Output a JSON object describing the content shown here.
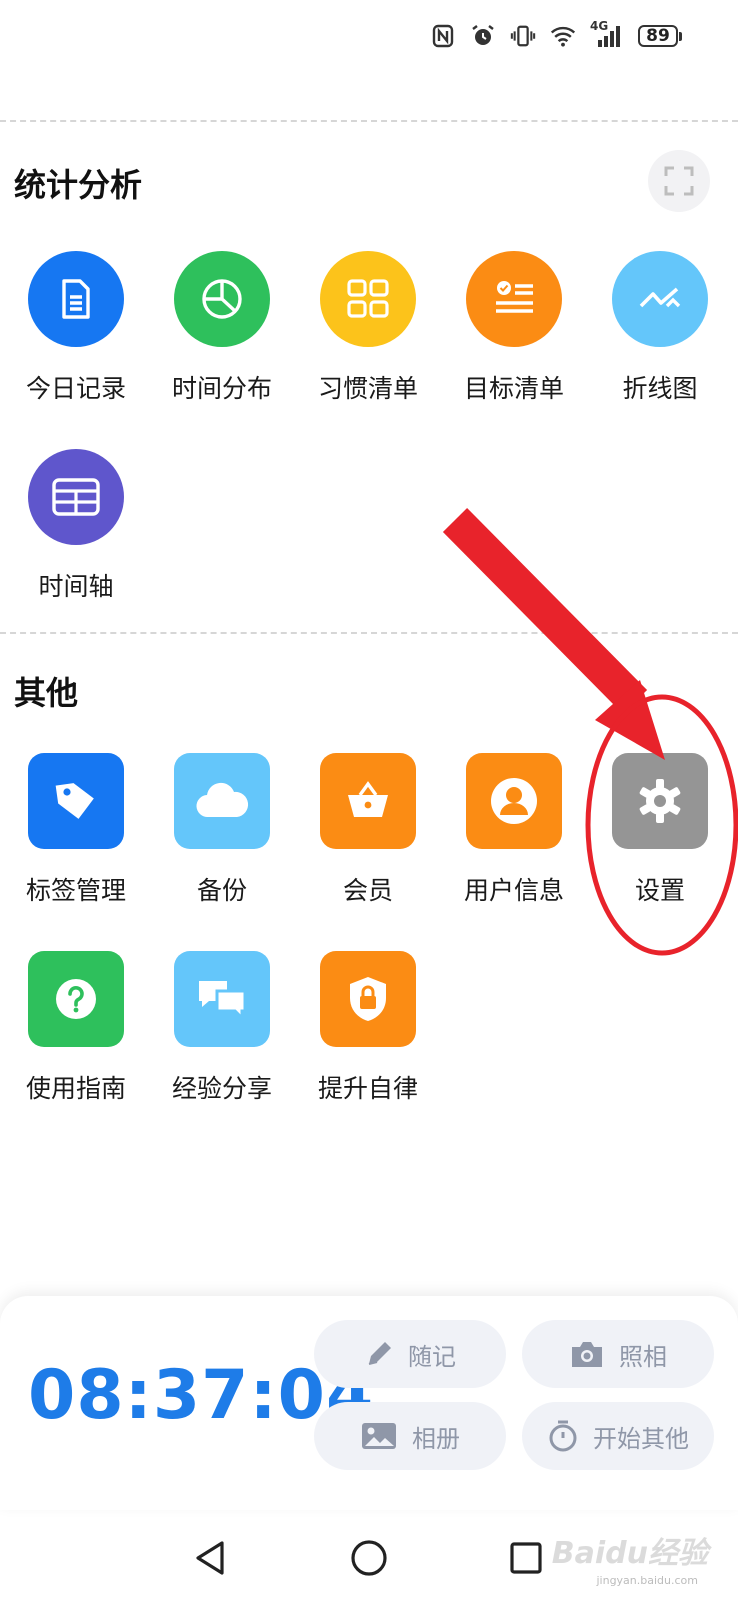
{
  "status_bar": {
    "icons": [
      "nfc-icon",
      "alarm-icon",
      "vibrate-icon",
      "wifi-icon",
      "signal-4g-icon"
    ],
    "network_label": "4G",
    "battery": "89"
  },
  "stats_section": {
    "title": "统计分析",
    "items": [
      {
        "label": "今日记录",
        "icon": "document-icon",
        "color": "#1677f2"
      },
      {
        "label": "时间分布",
        "icon": "pie-chart-icon",
        "color": "#2ec05c"
      },
      {
        "label": "习惯清单",
        "icon": "grid-icon",
        "color": "#fcc31b"
      },
      {
        "label": "目标清单",
        "icon": "checklist-icon",
        "color": "#fb8c14"
      },
      {
        "label": "折线图",
        "icon": "line-chart-icon",
        "color": "#64c6fa"
      },
      {
        "label": "时间轴",
        "icon": "table-icon",
        "color": "#5f56cc"
      }
    ]
  },
  "other_section": {
    "title": "其他",
    "items": [
      {
        "label": "标签管理",
        "icon": "tag-icon",
        "color": "#1677f2"
      },
      {
        "label": "备份",
        "icon": "cloud-icon",
        "color": "#64c6fa"
      },
      {
        "label": "会员",
        "icon": "basket-icon",
        "color": "#fb8c14"
      },
      {
        "label": "用户信息",
        "icon": "user-icon",
        "color": "#fb8c14"
      },
      {
        "label": "设置",
        "icon": "gear-icon",
        "color": "#959595"
      },
      {
        "label": "使用指南",
        "icon": "help-icon",
        "color": "#2ec05c"
      },
      {
        "label": "经验分享",
        "icon": "chat-icon",
        "color": "#64c6fa"
      },
      {
        "label": "提升自律",
        "icon": "shield-lock-icon",
        "color": "#fb8c14"
      }
    ]
  },
  "bottom_panel": {
    "clock": "08:37:04",
    "buttons": [
      {
        "label": "随记",
        "icon": "pencil-icon"
      },
      {
        "label": "照相",
        "icon": "camera-icon"
      },
      {
        "label": "相册",
        "icon": "image-icon"
      },
      {
        "label": "开始其他",
        "icon": "stopwatch-icon"
      }
    ]
  },
  "watermark": {
    "text": "Baidu经验",
    "sub": "jingyan.baidu.com"
  },
  "colors": {
    "accent": "#1e7ce8",
    "annotation": "#e8232b"
  }
}
